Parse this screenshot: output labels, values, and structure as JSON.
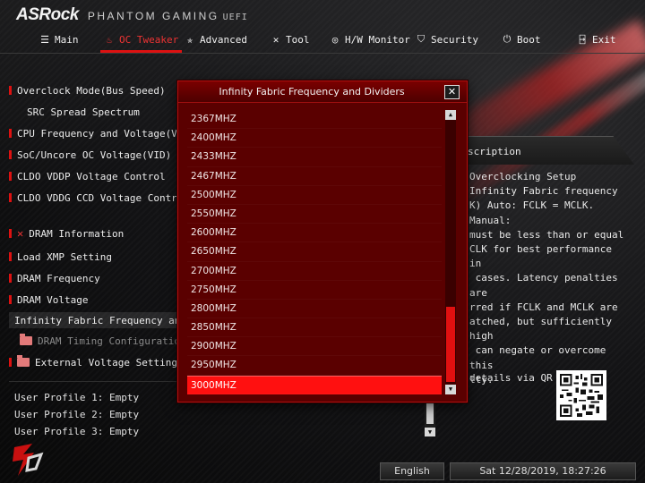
{
  "header": {
    "brand": "ASRock",
    "product": "PHANTOM GAMING",
    "uefi": "UEFI"
  },
  "nav": [
    {
      "label": "Main",
      "icon": "list-icon",
      "active": false
    },
    {
      "label": "OC Tweaker",
      "icon": "flame-icon",
      "active": true
    },
    {
      "label": "Advanced",
      "icon": "star-icon",
      "active": false
    },
    {
      "label": "Tool",
      "icon": "tools-icon",
      "active": false
    },
    {
      "label": "H/W Monitor",
      "icon": "globe-icon",
      "active": false
    },
    {
      "label": "Security",
      "icon": "shield-icon",
      "active": false
    },
    {
      "label": "Boot",
      "icon": "power-icon",
      "active": false
    },
    {
      "label": "Exit",
      "icon": "exit-icon",
      "active": false
    }
  ],
  "menu": [
    {
      "label": "Overclock Mode(Bus Speed)"
    },
    {
      "label": "SRC Spread Spectrum"
    },
    {
      "label": "CPU Frequency and Voltage(VID) Ch"
    },
    {
      "label": "SoC/Uncore OC Voltage(VID)"
    },
    {
      "label": "CLDO VDDP Voltage Control"
    },
    {
      "label": "CLDO VDDG CCD Voltage Control"
    },
    {
      "label": "DRAM Information"
    },
    {
      "label": "Load XMP Setting"
    },
    {
      "label": "DRAM Frequency"
    },
    {
      "label": "DRAM Voltage"
    },
    {
      "label": "Infinity Fabric Frequency and Divi"
    },
    {
      "label": "DRAM Timing Configuration"
    },
    {
      "label": "External Voltage Settings and"
    }
  ],
  "profiles": [
    "User Profile 1: Empty",
    "User Profile 2: Empty",
    "User Profile 3: Empty"
  ],
  "description": {
    "heading": "scription",
    "body": "Overclocking Setup\nInfinity Fabric frequency\nK) Auto: FCLK = MCLK. Manual:\nmust be less than or equal\nCLK for best performance in\n cases. Latency penalties are\nrred if FCLK and MCLK are\natched, but sufficiently high\n can negate or overcome this\nlty.",
    "qr_text": "details via QR"
  },
  "footer": {
    "language": "English",
    "datetime": "Sat 12/28/2019, 18:27:26"
  },
  "modal": {
    "title": "Infinity Fabric Frequency and Dividers",
    "close": "✕",
    "options": [
      "2367MHZ",
      "2400MHZ",
      "2433MHZ",
      "2467MHZ",
      "2500MHZ",
      "2550MHZ",
      "2600MHZ",
      "2650MHZ",
      "2700MHZ",
      "2750MHZ",
      "2800MHZ",
      "2850MHZ",
      "2900MHZ",
      "2950MHZ",
      "3000MHZ"
    ],
    "selected_index": 14
  },
  "colors": {
    "accent": "#dd1111",
    "modal_bg": "#5a0000",
    "selected": "#ff1010"
  }
}
